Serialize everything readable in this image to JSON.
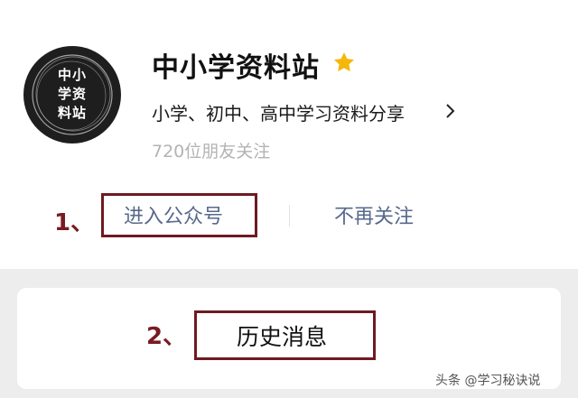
{
  "account": {
    "avatar_lines": [
      "中小",
      "学资",
      "料站"
    ],
    "name": "中小学资料站",
    "star_icon": "star-icon",
    "star_color": "#f5b70a",
    "description": "小学、初中、高中学习资料分享",
    "followers": "720位朋友关注"
  },
  "actions": {
    "enter_label": "进入公众号",
    "unfollow_label": "不再关注"
  },
  "history": {
    "label": "历史消息"
  },
  "annotations": {
    "step1": "1、",
    "step2": "2、",
    "box_color": "#6e1a22"
  },
  "watermark": "头条 @学习秘诀说"
}
